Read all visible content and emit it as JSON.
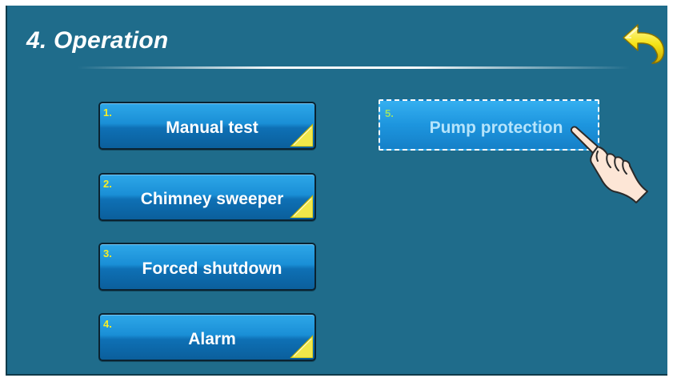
{
  "header": {
    "title": "4. Operation"
  },
  "menu": {
    "items": [
      {
        "number": "1.",
        "label": "Manual test"
      },
      {
        "number": "2.",
        "label": "Chimney sweeper"
      },
      {
        "number": "3.",
        "label": "Forced shutdown"
      },
      {
        "number": "4.",
        "label": "Alarm"
      },
      {
        "number": "5.",
        "label": "Pump protection"
      }
    ]
  },
  "icons": {
    "back": "back-arrow-icon",
    "pointer": "pointing-hand-icon"
  },
  "colors": {
    "background": "#1f6c8b",
    "button_top": "#2ea7e8",
    "button_bottom": "#0b5f9c",
    "number": "#f6ef25",
    "selected_label": "#b5e4fb",
    "selected_number": "#9be26a",
    "back_arrow": "#f5e418"
  }
}
